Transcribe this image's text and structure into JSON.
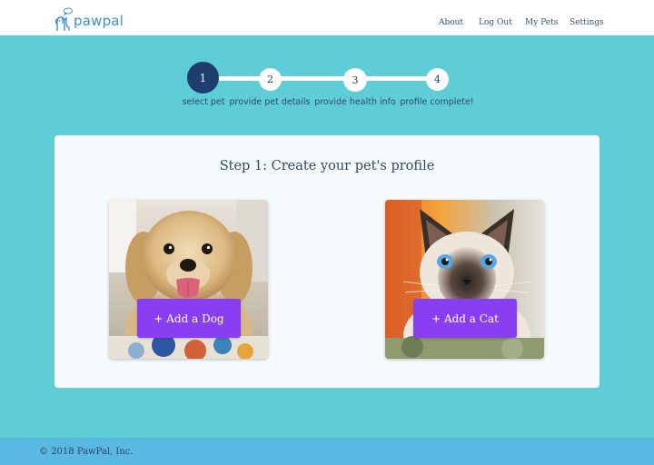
{
  "brand": {
    "name": "pawpal",
    "logo_icon": "dog-cat-bubble-icon"
  },
  "nav": {
    "about": "About",
    "logout": "Log Out",
    "my_pets": "My Pets",
    "settings": "Settings"
  },
  "stepper": {
    "current_step": 1,
    "steps": [
      {
        "number": "1",
        "label": "select pet"
      },
      {
        "number": "2",
        "label": "provide pet details"
      },
      {
        "number": "3",
        "label": "provide health info"
      },
      {
        "number": "4",
        "label": "profile complete!"
      }
    ]
  },
  "main": {
    "title": "Step 1: Create your pet's profile",
    "options": [
      {
        "button_label": "+ Add a Dog",
        "image": "dog-photo"
      },
      {
        "button_label": "+ Add a Cat",
        "image": "cat-photo"
      }
    ]
  },
  "footer": {
    "copyright_symbol": "©",
    "text": "2018 PawPal, Inc."
  },
  "colors": {
    "page_background": "#5ecdd6",
    "header_background": "#ffffff",
    "footer_background": "#5ab9e2",
    "accent_button": "#8a3ef2",
    "step_active": "#1e3f6e",
    "brand_text": "#3e8fd0"
  }
}
